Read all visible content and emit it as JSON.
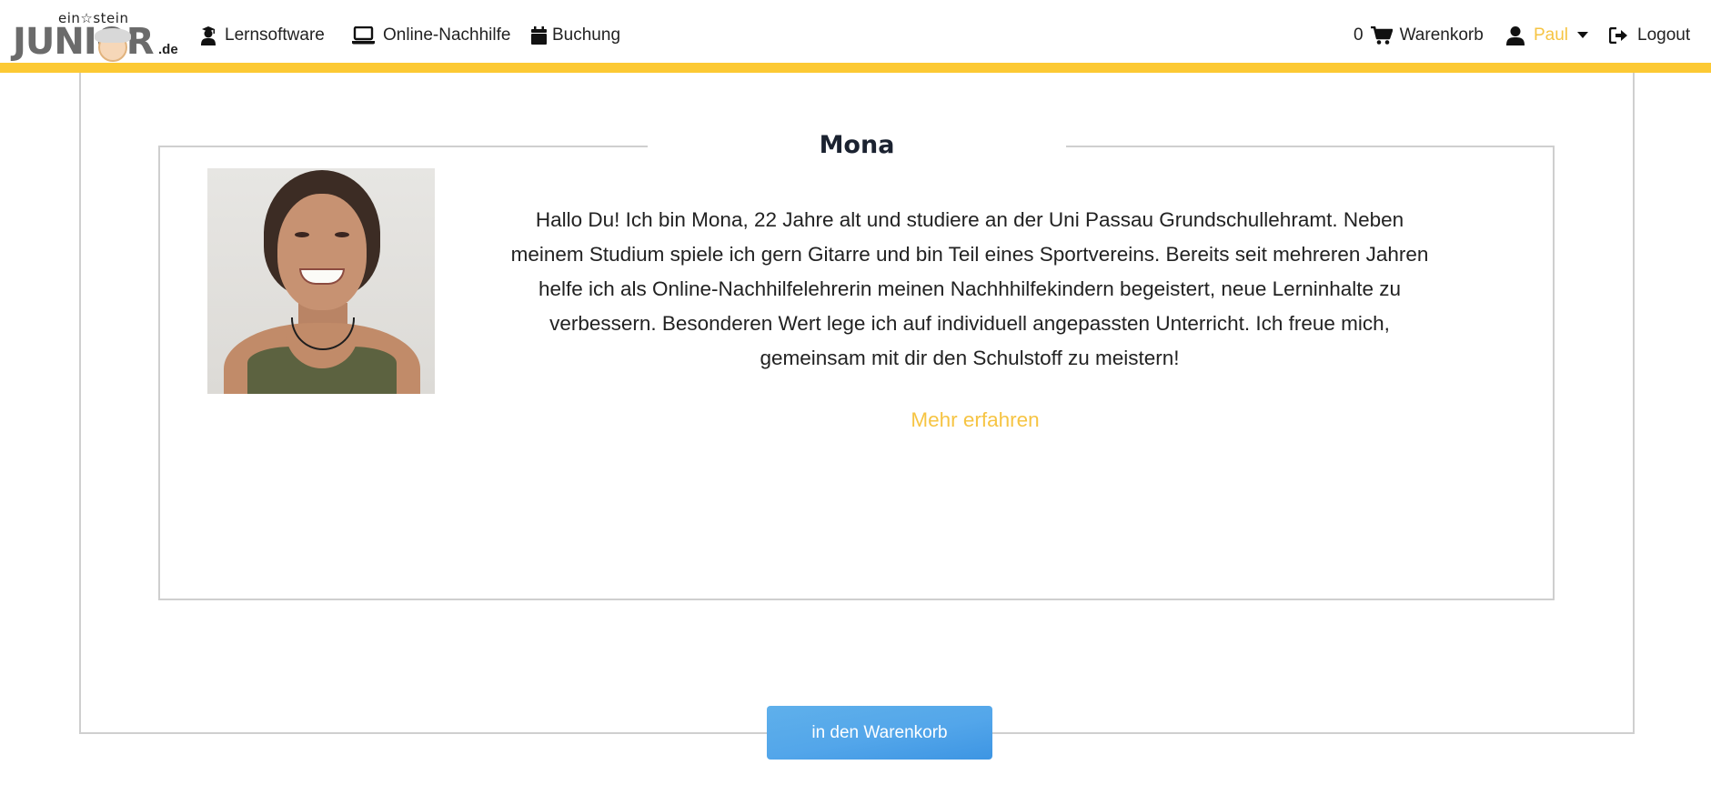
{
  "brand": {
    "logo_top": "ein☆stein",
    "logo_main": "JUNIOR",
    "logo_suffix": ".de"
  },
  "nav": {
    "lernsoftware": "Lernsoftware",
    "nachhilfe": "Online-Nachhilfe",
    "buchung": "Buchung",
    "cart_count": "0",
    "cart_label": "Warenkorb",
    "user_label": "Paul",
    "logout_label": "Logout"
  },
  "profile": {
    "name": "Mona",
    "bio": "Hallo Du! Ich bin Mona, 22 Jahre alt und studiere an der Uni Passau Grundschullehramt. Neben meinem Studium spiele ich gern Gitarre und bin Teil eines Sportvereins. Bereits seit mehreren Jahren helfe ich als Online-Nachhilfelehrerin meinen Nachhhilfekindern begeistert, neue Lerninhalte zu verbessern. Besonderen Wert lege ich auf individuell angepassten Unterricht. Ich freue mich, gemeinsam mit dir den Schulstoff zu meistern!",
    "more_link": "Mehr erfahren"
  },
  "actions": {
    "add_to_cart": "in den Warenkorb"
  },
  "colors": {
    "accent_yellow": "#fcc934",
    "link_yellow": "#f6c443",
    "button_blue": "#53a6ea",
    "border_gray": "#cfcfcf"
  }
}
